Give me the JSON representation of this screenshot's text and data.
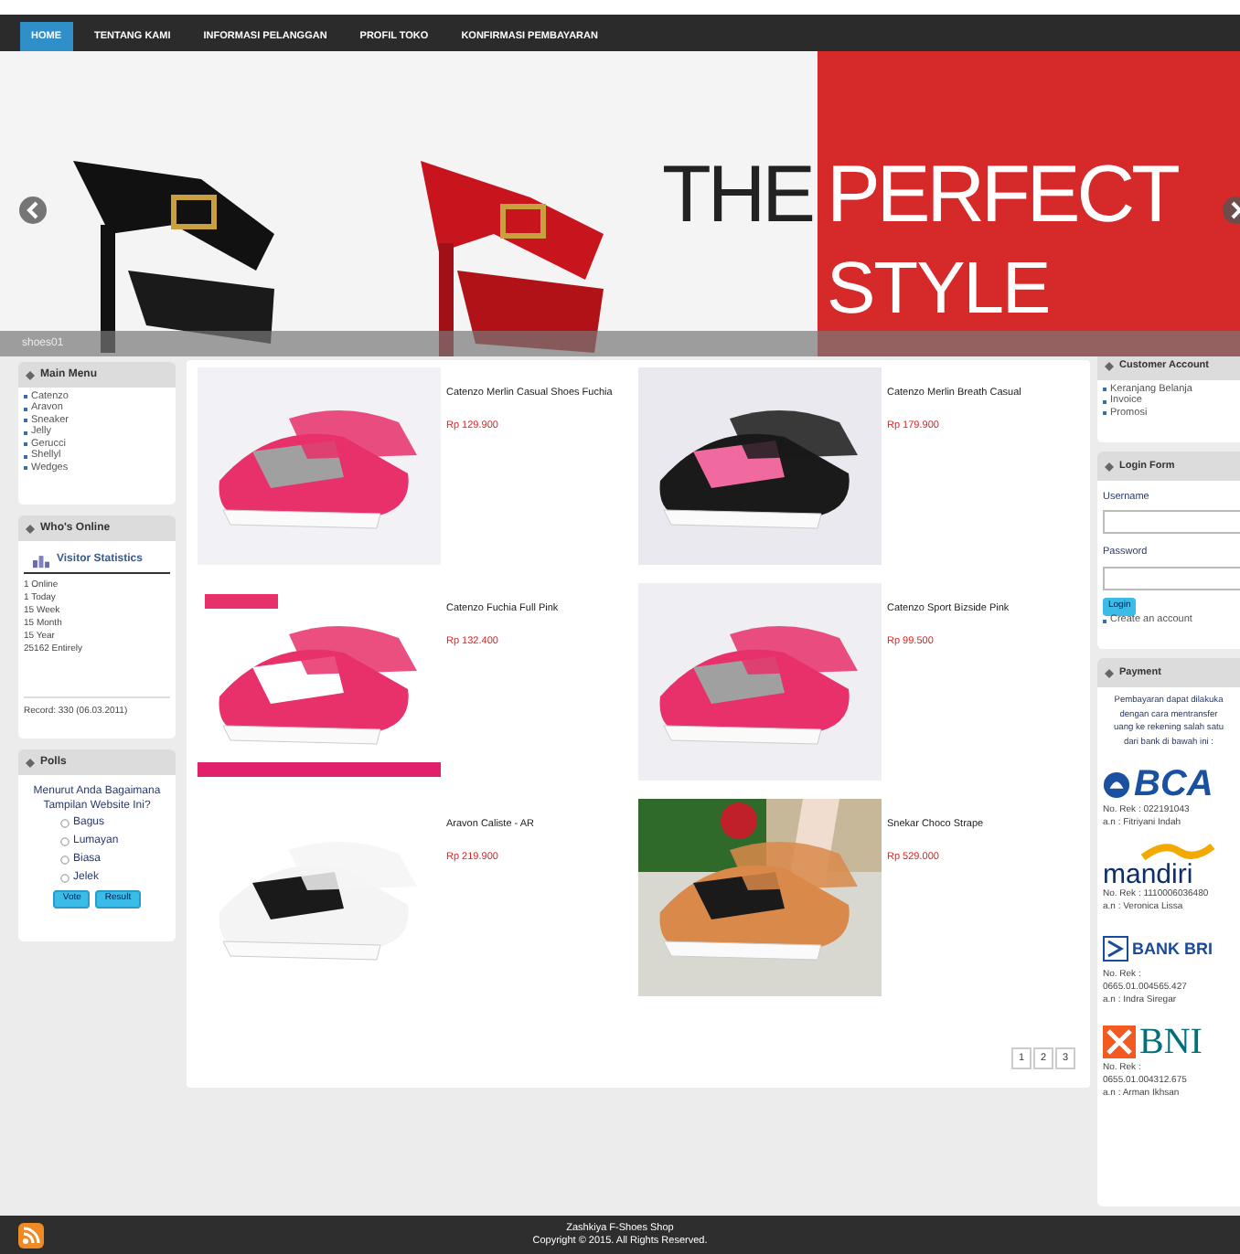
{
  "nav": [
    {
      "label": "HOME",
      "selected": true
    },
    {
      "label": "TENTANG KAMI",
      "selected": false
    },
    {
      "label": "INFORMASI PELANGGAN",
      "selected": false
    },
    {
      "label": "PROFIL TOKO",
      "selected": false
    },
    {
      "label": "KONFIRMASI PEMBAYARAN",
      "selected": false
    }
  ],
  "banner": {
    "headline_1": "THE",
    "headline_2": "PERFECT",
    "headline_3": "STYLE",
    "caption": "shoes01"
  },
  "left_sidebar": {
    "main_menu": {
      "title": "Main Menu",
      "items": [
        "Catenzo",
        "Aravon",
        "Sneaker",
        "Jelly",
        "Gerucci",
        "Shellyl",
        "Wedges"
      ]
    },
    "whos_online": {
      "title": "Who's Online",
      "stats_title": "Visitor Statistics",
      "stats": [
        "1 Online",
        "1 Today",
        "15 Week",
        "15 Month",
        "15 Year",
        "25162 Entirely"
      ],
      "record": "Record: 330 (06.03.2011)"
    },
    "polls": {
      "title": "Polls",
      "question": "Menurut Anda Bagaimana Tampilan Website Ini?",
      "options": [
        {
          "label": "Bagus",
          "selected": false
        },
        {
          "label": "Lumayan",
          "selected": false
        },
        {
          "label": "Biasa",
          "selected": false
        },
        {
          "label": "Jelek",
          "selected": false
        }
      ],
      "buttons": [
        "Vote",
        "Result"
      ]
    }
  },
  "products": [
    {
      "name": "Catenzo Merlin Casual Shoes Fuchia",
      "price": "Rp 129.900"
    },
    {
      "name": "Catenzo Merlin Breath Casual",
      "price": "Rp 179.900"
    },
    {
      "name": "Catenzo Fuchia Full Pink",
      "price": "Rp 132.400"
    },
    {
      "name": "Catenzo Sport Bizside Pink",
      "price": "Rp 99.500"
    },
    {
      "name": "Aravon Caliste - AR",
      "price": "Rp 219.900"
    },
    {
      "name": "Snekar Choco Strape",
      "price": "Rp 529.000"
    }
  ],
  "pages": [
    "1",
    "2",
    "3"
  ],
  "right_sidebar": {
    "customer_account": {
      "title": "Customer Account",
      "items": [
        "Keranjang Belanja",
        "Invoice",
        "Promosi"
      ]
    },
    "login_form": {
      "title": "Login Form",
      "username_label": "Username",
      "password_label": "Password",
      "button": "Login",
      "link": "Create an account"
    },
    "payment": {
      "title": "Payment",
      "note_lines": [
        "Pembayaran dapat dilakuka",
        "dengan cara mentransfer",
        "uang ke rekening salah satu",
        "dari bank di bawah ini :"
      ],
      "banks": [
        {
          "kind": "bca",
          "logo": "BCA",
          "lines": [
            "No. Rek : 022191043",
            "a.n : Fitriyani Indah"
          ]
        },
        {
          "kind": "mandiri",
          "logo": "mandiri",
          "lines": [
            "No. Rek : 1110006036480",
            "a.n : Veronica Lissa"
          ]
        },
        {
          "kind": "bri",
          "logo": "BANK BRI",
          "lines": [
            "No. Rek :",
            "0665.01.004565.427",
            "a.n : Indra Siregar"
          ]
        },
        {
          "kind": "bni",
          "logo": "BNI",
          "lines": [
            "No. Rek :",
            "0655.01.004312.675",
            "a.n : Arman Ikhsan"
          ]
        }
      ]
    }
  },
  "footer": {
    "shop": "Zashkiya F-Shoes Shop",
    "copyright": "Copyright © 2015. All Rights Reserved."
  }
}
